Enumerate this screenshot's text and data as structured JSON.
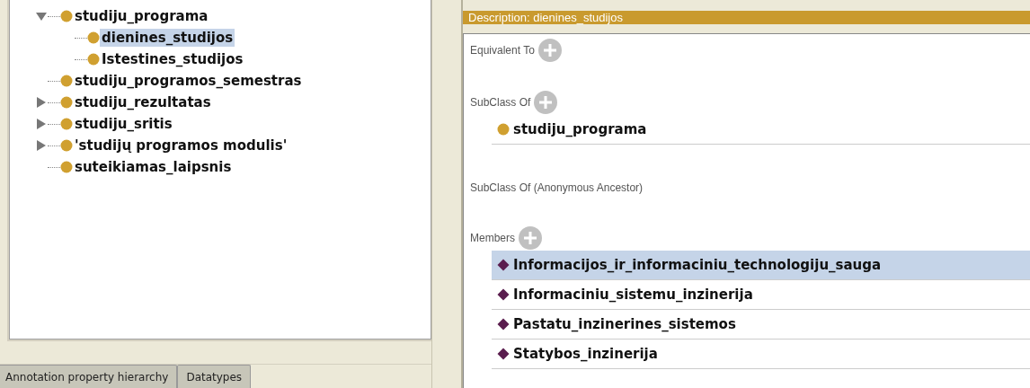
{
  "class_tree": [
    {
      "label": "studiju_programa",
      "kind": "branch",
      "expanded": true,
      "selected": false,
      "children": [
        {
          "label": "dienines_studijos",
          "kind": "leaf",
          "selected": true
        },
        {
          "label": "Istestines_studijos",
          "kind": "leaf",
          "selected": false
        }
      ]
    },
    {
      "label": "studiju_programos_semestras",
      "kind": "leaf",
      "selected": false
    },
    {
      "label": "studiju_rezultatas",
      "kind": "branch",
      "expanded": false,
      "selected": false
    },
    {
      "label": "studiju_sritis",
      "kind": "branch",
      "expanded": false,
      "selected": false
    },
    {
      "label": "'studijų programos modulis'",
      "kind": "branch",
      "expanded": false,
      "selected": false
    },
    {
      "label": "suteikiamas_laipsnis",
      "kind": "leaf",
      "selected": false
    }
  ],
  "tabs": [
    {
      "label": "Annotation property hierarchy",
      "selected": false
    },
    {
      "label": "Datatypes",
      "selected": false
    }
  ],
  "description": {
    "title": "Description: dienines_studijos",
    "sections": [
      {
        "title": "Equivalent To",
        "addable": true
      },
      {
        "title": "SubClass Of",
        "addable": true,
        "items": [
          {
            "label": "studiju_programa",
            "kind": "class",
            "selected": false
          }
        ]
      },
      {
        "title": "SubClass Of (Anonymous Ancestor)",
        "addable": false
      },
      {
        "title": "Members",
        "addable": true,
        "items": [
          {
            "label": "Informacijos_ir_informaciniu_technologiju_sauga",
            "kind": "individual",
            "selected": true
          },
          {
            "label": "Informaciniu_sistemu_inzinerija",
            "kind": "individual",
            "selected": false
          },
          {
            "label": "Pastatu_inzinerines_sistemos",
            "kind": "individual",
            "selected": false
          },
          {
            "label": "Statybos_inzinerija",
            "kind": "individual",
            "selected": false
          }
        ]
      }
    ]
  }
}
